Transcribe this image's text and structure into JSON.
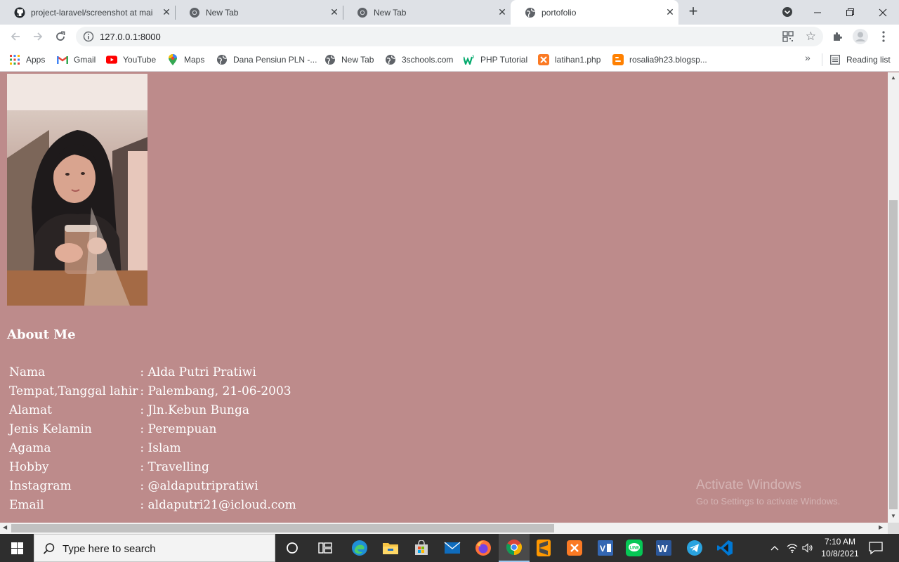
{
  "browser": {
    "tabs": [
      {
        "title": "project-laravel/screenshot at mai",
        "icon": "github-icon",
        "active": false
      },
      {
        "title": "New Tab",
        "icon": "chrome-icon",
        "active": false
      },
      {
        "title": "New Tab",
        "icon": "chrome-icon",
        "active": false
      },
      {
        "title": "portofolio",
        "icon": "globe-icon",
        "active": true
      }
    ],
    "new_tab_label": "+",
    "url": "127.0.0.1:8000",
    "bookmarks": [
      {
        "label": "Apps",
        "icon": "apps-grid-icon"
      },
      {
        "label": "Gmail",
        "icon": "gmail-icon"
      },
      {
        "label": "YouTube",
        "icon": "youtube-icon"
      },
      {
        "label": "Maps",
        "icon": "maps-pin-icon"
      },
      {
        "label": "Dana Pensiun PLN -...",
        "icon": "globe-icon"
      },
      {
        "label": "New Tab",
        "icon": "globe-icon"
      },
      {
        "label": "3schools.com",
        "icon": "globe-icon"
      },
      {
        "label": "PHP Tutorial",
        "icon": "w3schools-icon"
      },
      {
        "label": "latihan1.php",
        "icon": "xampp-icon"
      },
      {
        "label": "rosalia9h23.blogsp...",
        "icon": "blogger-icon"
      }
    ],
    "bookmarks_more": "»",
    "reading_list": "Reading list"
  },
  "page": {
    "about_title": "About Me",
    "bio": [
      {
        "label": "Nama",
        "value": ": Alda Putri Pratiwi"
      },
      {
        "label": "Tempat,Tanggal lahir",
        "value": ": Palembang, 21-06-2003"
      },
      {
        "label": "Alamat",
        "value": ": Jln.Kebun Bunga"
      },
      {
        "label": "Jenis Kelamin",
        "value": ": Perempuan"
      },
      {
        "label": "Agama",
        "value": ": Islam"
      },
      {
        "label": "Hobby",
        "value": ": Travelling"
      },
      {
        "label": "Instagram",
        "value": ": @aldaputripratiwi"
      },
      {
        "label": "Email",
        "value": ": aldaputri21@icloud.com"
      }
    ],
    "background_color": "#bd8b8b"
  },
  "watermark": {
    "line1": "Activate Windows",
    "line2": "Go to Settings to activate Windows."
  },
  "taskbar": {
    "search_placeholder": "Type here to search",
    "apps": [
      "cortana-icon",
      "task-view-icon",
      "edge-icon",
      "file-explorer-icon",
      "store-icon",
      "mail-icon",
      "firefox-icon",
      "chrome-icon",
      "sublime-icon",
      "xampp-icon",
      "visual-studio-icon",
      "line-icon",
      "word-icon",
      "telegram-icon",
      "vscode-icon"
    ],
    "time": "7:10 AM",
    "date": "10/8/2021"
  }
}
